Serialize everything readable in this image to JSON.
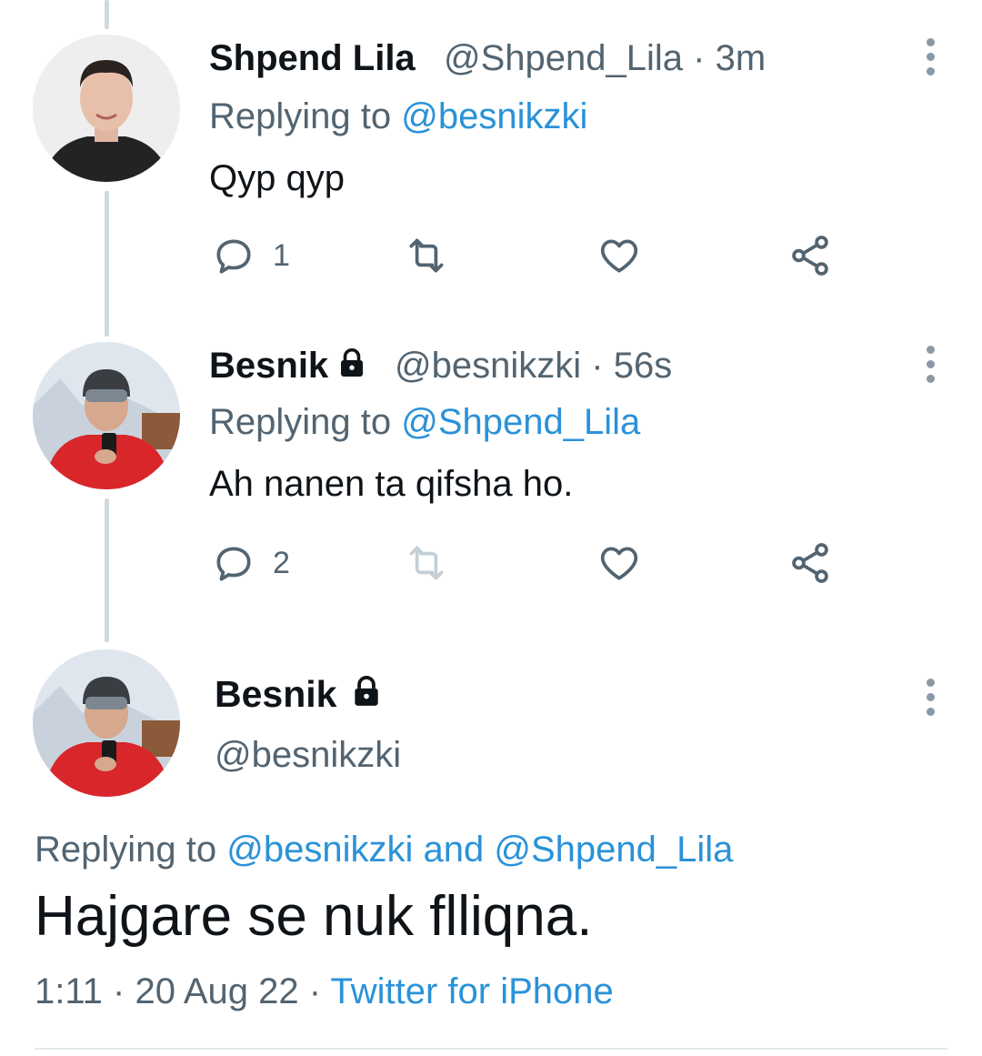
{
  "colors": {
    "link": "#2a92d8",
    "muted": "#536471",
    "text": "#0f1419",
    "thread": "#cfd9de"
  },
  "tweets": [
    {
      "name": "Shpend Lila",
      "handle": "@Shpend_Lila",
      "separator": "·",
      "time": "3m",
      "replying_prefix": "Replying to",
      "replying_to": "@besnikzki",
      "text": "Qyp qyp",
      "reply_count": "1",
      "retweet_count": "",
      "locked": false,
      "avatar": "avatar-shpend"
    },
    {
      "name": "Besnik",
      "handle": "@besnikzki",
      "separator": "·",
      "time": "56s",
      "replying_prefix": "Replying to",
      "replying_to": "@Shpend_Lila",
      "text": "Ah nanen ta qifsha ho.",
      "reply_count": "2",
      "retweet_count": "",
      "locked": true,
      "avatar": "avatar-besnik"
    }
  ],
  "main_tweet": {
    "name": "Besnik",
    "handle": "@besnikzki",
    "replying_prefix": "Replying to",
    "replying_to_1": "@besnikzki",
    "replying_and": "and",
    "replying_to_2": "@Shpend_Lila",
    "text": "Hajgare se nuk flliqna.",
    "time": "1:11",
    "separator": "·",
    "date": "20 Aug 22",
    "source": "Twitter for iPhone"
  },
  "icons": [
    "reply-icon",
    "retweet-icon",
    "like-icon",
    "share-icon",
    "more-icon",
    "lock-icon"
  ]
}
